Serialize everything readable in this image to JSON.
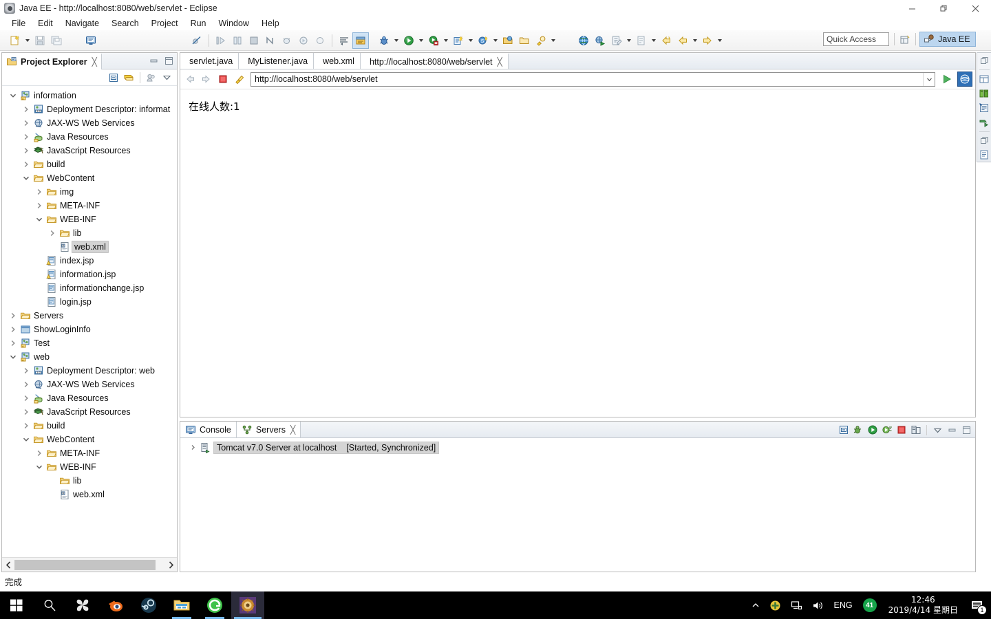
{
  "window": {
    "title": "Java EE - http://localhost:8080/web/servlet - Eclipse",
    "icon": "eclipse-icon",
    "minimize": "minimize-icon",
    "restore": "restore-icon",
    "close": "close-icon"
  },
  "menu": {
    "items": [
      {
        "label": "File"
      },
      {
        "label": "Edit"
      },
      {
        "label": "Navigate"
      },
      {
        "label": "Search"
      },
      {
        "label": "Project"
      },
      {
        "label": "Run"
      },
      {
        "label": "Window"
      },
      {
        "label": "Help"
      }
    ]
  },
  "toolbar": {
    "quick_access_placeholder": "Quick Access",
    "open_perspective": "open-perspective-icon",
    "perspective_label": "Java EE",
    "buttons": [
      {
        "name": "new-wizard",
        "icon": "new-file-icon"
      },
      {
        "name": "save",
        "icon": "save-icon"
      },
      {
        "name": "save-all",
        "icon": "save-all-icon"
      },
      {
        "name": "new-jsp",
        "icon": "console-view-icon"
      },
      {
        "name": "toggle-breakpoint",
        "icon": "skip-breakpoints-icon"
      },
      {
        "name": "step-into",
        "icon": "step-into-icon"
      },
      {
        "name": "step-over",
        "icon": "step-over-icon"
      },
      {
        "name": "terminate",
        "icon": "terminate-icon"
      },
      {
        "name": "relaunch",
        "icon": "relaunch-icon"
      },
      {
        "name": "debug-drop",
        "icon": "debug-small-icon"
      },
      {
        "name": "run-small",
        "icon": "run-small-icon"
      },
      {
        "name": "coverage",
        "icon": "coverage-icon"
      },
      {
        "name": "format",
        "icon": "format-icon"
      },
      {
        "name": "jsp-editor",
        "icon": "jsp-editor-icon"
      },
      {
        "name": "debug",
        "icon": "debug-icon"
      },
      {
        "name": "run",
        "icon": "run-icon"
      },
      {
        "name": "run-external",
        "icon": "external-tools-icon"
      },
      {
        "name": "new-java-project",
        "icon": "new-java-project-icon"
      },
      {
        "name": "new-servlet",
        "icon": "new-servlet-icon"
      },
      {
        "name": "open-type",
        "icon": "open-type-icon"
      },
      {
        "name": "open-task",
        "icon": "open-task-icon"
      },
      {
        "name": "search-all",
        "icon": "search-icon"
      },
      {
        "name": "web-browser",
        "icon": "globe-icon"
      },
      {
        "name": "run-on-server",
        "icon": "run-on-server-icon"
      },
      {
        "name": "new-annotation",
        "icon": "annotation-icon"
      },
      {
        "name": "next-annotation",
        "icon": "next-annotation-icon"
      },
      {
        "name": "back",
        "icon": "back-arrow-icon"
      },
      {
        "name": "forward",
        "icon": "forward-arrow-icon"
      }
    ]
  },
  "explorer": {
    "tab_label": "Project Explorer",
    "tab_icon": "project-explorer-icon",
    "tab_close": "╳",
    "minimize": "minimize-view-icon",
    "maximize": "maximize-view-icon",
    "toolbar": [
      {
        "name": "collapse-all",
        "icon": "collapse-all-icon"
      },
      {
        "name": "link-with-editor",
        "icon": "link-editor-icon"
      },
      {
        "name": "focus-on-active-task",
        "icon": "focus-task-icon"
      },
      {
        "name": "view-menu",
        "icon": "view-menu-icon"
      }
    ],
    "tree": [
      {
        "indent": 0,
        "twisty": "down",
        "icon": "dynamic-web-project-icon",
        "label": "information",
        "selected": false
      },
      {
        "indent": 1,
        "twisty": "right",
        "icon": "deployment-descriptor-icon",
        "label": "Deployment Descriptor: informat",
        "selected": false
      },
      {
        "indent": 1,
        "twisty": "right",
        "icon": "jaxws-icon",
        "label": "JAX-WS Web Services",
        "selected": false
      },
      {
        "indent": 1,
        "twisty": "right",
        "icon": "java-resources-icon",
        "label": "Java Resources",
        "selected": false
      },
      {
        "indent": 1,
        "twisty": "right",
        "icon": "javascript-resources-icon",
        "label": "JavaScript Resources",
        "selected": false
      },
      {
        "indent": 1,
        "twisty": "right",
        "icon": "folder-icon",
        "label": "build",
        "selected": false
      },
      {
        "indent": 1,
        "twisty": "down",
        "icon": "folder-icon",
        "label": "WebContent",
        "selected": false
      },
      {
        "indent": 2,
        "twisty": "right",
        "icon": "folder-icon",
        "label": "img",
        "selected": false
      },
      {
        "indent": 2,
        "twisty": "right",
        "icon": "folder-icon",
        "label": "META-INF",
        "selected": false
      },
      {
        "indent": 2,
        "twisty": "down",
        "icon": "folder-icon",
        "label": "WEB-INF",
        "selected": false
      },
      {
        "indent": 3,
        "twisty": "right",
        "icon": "folder-icon",
        "label": "lib",
        "selected": false
      },
      {
        "indent": 3,
        "twisty": "none",
        "icon": "xml-file-icon",
        "label": "web.xml",
        "selected": true
      },
      {
        "indent": 2,
        "twisty": "none",
        "icon": "jsp-warning-icon",
        "label": "index.jsp",
        "selected": false
      },
      {
        "indent": 2,
        "twisty": "none",
        "icon": "jsp-warning-icon",
        "label": "information.jsp",
        "selected": false
      },
      {
        "indent": 2,
        "twisty": "none",
        "icon": "jsp-file-icon",
        "label": "informationchange.jsp",
        "selected": false
      },
      {
        "indent": 2,
        "twisty": "none",
        "icon": "jsp-file-icon",
        "label": "login.jsp",
        "selected": false
      },
      {
        "indent": 0,
        "twisty": "right",
        "icon": "folder-icon",
        "label": "Servers",
        "selected": false
      },
      {
        "indent": 0,
        "twisty": "right",
        "icon": "project-icon",
        "label": "ShowLoginInfo",
        "selected": false
      },
      {
        "indent": 0,
        "twisty": "right",
        "icon": "dynamic-web-project-icon",
        "label": "Test",
        "selected": false
      },
      {
        "indent": 0,
        "twisty": "down",
        "icon": "dynamic-web-project-icon",
        "label": "web",
        "selected": false
      },
      {
        "indent": 1,
        "twisty": "right",
        "icon": "deployment-descriptor-icon",
        "label": "Deployment Descriptor: web",
        "selected": false
      },
      {
        "indent": 1,
        "twisty": "right",
        "icon": "jaxws-icon",
        "label": "JAX-WS Web Services",
        "selected": false
      },
      {
        "indent": 1,
        "twisty": "right",
        "icon": "java-resources-icon",
        "label": "Java Resources",
        "selected": false
      },
      {
        "indent": 1,
        "twisty": "right",
        "icon": "javascript-resources-icon",
        "label": "JavaScript Resources",
        "selected": false
      },
      {
        "indent": 1,
        "twisty": "right",
        "icon": "folder-icon",
        "label": "build",
        "selected": false
      },
      {
        "indent": 1,
        "twisty": "down",
        "icon": "folder-icon",
        "label": "WebContent",
        "selected": false
      },
      {
        "indent": 2,
        "twisty": "right",
        "icon": "folder-icon",
        "label": "META-INF",
        "selected": false
      },
      {
        "indent": 2,
        "twisty": "down",
        "icon": "folder-icon",
        "label": "WEB-INF",
        "selected": false
      },
      {
        "indent": 3,
        "twisty": "none",
        "icon": "folder-icon",
        "label": "lib",
        "selected": false
      },
      {
        "indent": 3,
        "twisty": "none",
        "icon": "xml-file-icon",
        "label": "web.xml",
        "selected": false
      }
    ]
  },
  "editor": {
    "tabs": [
      {
        "label": "servlet.java",
        "icon": "java-file-icon",
        "active": false,
        "closable": false
      },
      {
        "label": "MyListener.java",
        "icon": "java-file-icon",
        "active": false,
        "closable": false
      },
      {
        "label": "web.xml",
        "icon": "xml-file-icon",
        "active": false,
        "closable": false
      },
      {
        "label": "http://localhost:8080/web/servlet",
        "icon": "globe-icon",
        "active": true,
        "closable": true
      }
    ],
    "tab_close": "╳",
    "browser": {
      "back": "back-icon",
      "forward": "forward-icon",
      "stop": "stop-icon",
      "refresh": "refresh-icon",
      "url": "http://localhost:8080/web/servlet",
      "dropdown": "chevron-down-icon",
      "go": "go-icon",
      "open_external": "open-external-browser-icon",
      "page_text": "在线人数:1"
    }
  },
  "fastbar": {
    "buttons": [
      {
        "name": "restore-view",
        "icon": "restore-view-icon"
      },
      {
        "name": "properties-view",
        "icon": "properties-view-icon"
      },
      {
        "name": "servers-view",
        "icon": "servers-view-icon"
      },
      {
        "name": "snippets-view",
        "icon": "snippets-view-icon"
      },
      {
        "name": "markers-view",
        "icon": "markers-view-icon"
      },
      {
        "name": "restore-view-2",
        "icon": "restore-view-icon"
      },
      {
        "name": "outline-view",
        "icon": "outline-view-icon"
      }
    ]
  },
  "console_panel": {
    "tabs": [
      {
        "label": "Console",
        "icon": "console-icon",
        "active": false,
        "closable": false
      },
      {
        "label": "Servers",
        "icon": "servers-icon",
        "active": true,
        "closable": true
      }
    ],
    "tab_close": "╳",
    "tools": [
      {
        "name": "collapse-all",
        "icon": "collapse-all-icon"
      },
      {
        "name": "debug-server",
        "icon": "debug-server-icon"
      },
      {
        "name": "start-server",
        "icon": "start-server-icon"
      },
      {
        "name": "profile-server",
        "icon": "profile-server-icon"
      },
      {
        "name": "stop-server",
        "icon": "stop-server-icon"
      },
      {
        "name": "publish-server",
        "icon": "publish-server-icon"
      },
      {
        "name": "view-menu",
        "icon": "view-menu-icon"
      },
      {
        "name": "minimize",
        "icon": "minimize-view-icon"
      },
      {
        "name": "maximize",
        "icon": "maximize-view-icon"
      }
    ],
    "servers": [
      {
        "icon": "server-icon",
        "name": "Tomcat v7.0 Server at localhost",
        "status": "[Started, Synchronized]",
        "selected": true
      }
    ]
  },
  "statusbar": {
    "text": "完成"
  },
  "taskbar": {
    "start": "windows-start-icon",
    "search": "search-icon",
    "items": [
      {
        "name": "pinwheel-app-icon",
        "active": false,
        "open": false
      },
      {
        "name": "blender-icon",
        "active": false,
        "open": false
      },
      {
        "name": "steam-icon",
        "active": false,
        "open": false
      },
      {
        "name": "file-explorer-icon",
        "active": false,
        "open": true
      },
      {
        "name": "edge-browser-icon",
        "active": false,
        "open": true
      },
      {
        "name": "eclipse-icon",
        "active": true,
        "open": true
      }
    ],
    "tray": {
      "expand": "chevron-up-icon",
      "shield": "security-icon",
      "network": "network-icon",
      "volume": "volume-icon",
      "language": "ENG",
      "badge_count": "41",
      "time": "12:46",
      "date": "2019/4/14 星期日",
      "notification": "notification-icon",
      "notification_count": "1"
    }
  }
}
